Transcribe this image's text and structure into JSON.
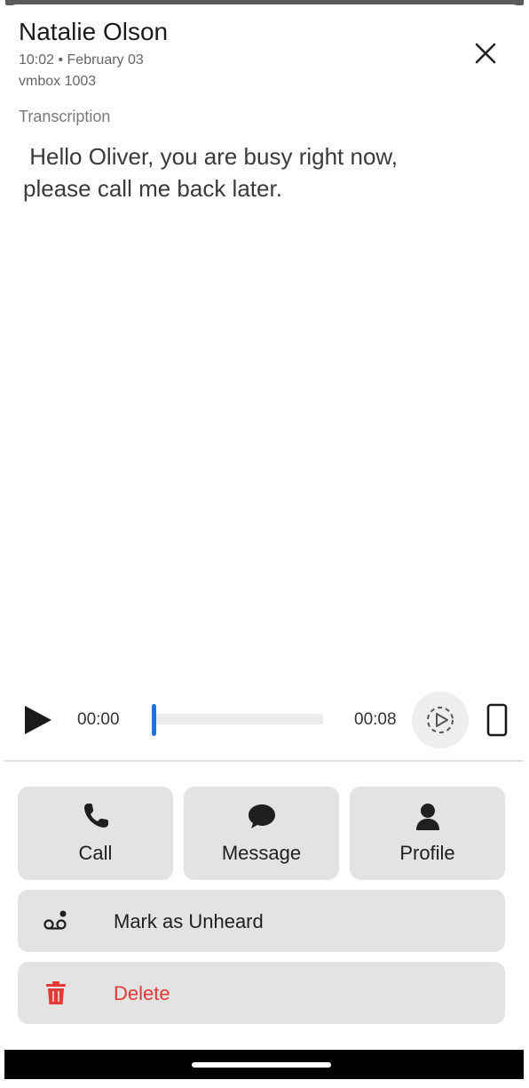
{
  "header": {
    "caller_name": "Natalie Olson",
    "timestamp": "10:02 • February 03",
    "mailbox": "vmbox 1003",
    "close_icon": "close-icon"
  },
  "transcription": {
    "label": "Transcription",
    "text": " Hello Oliver, you are busy right now,\nplease call me back later."
  },
  "player": {
    "elapsed": "00:00",
    "duration": "00:08",
    "progress": 0.0,
    "play_icon": "play-icon",
    "speed_icon": "playback-speed-icon",
    "output_icon": "phone-device-icon",
    "accent_color": "#1a73e8"
  },
  "actions": {
    "call": {
      "label": "Call",
      "icon": "phone-icon"
    },
    "message": {
      "label": "Message",
      "icon": "chat-bubble-icon"
    },
    "profile": {
      "label": "Profile",
      "icon": "person-icon"
    },
    "mark_unheard": {
      "label": "Mark as Unheard",
      "icon": "voicemail-icon"
    },
    "delete": {
      "label": "Delete",
      "icon": "trash-icon",
      "color": "#e53935"
    }
  }
}
